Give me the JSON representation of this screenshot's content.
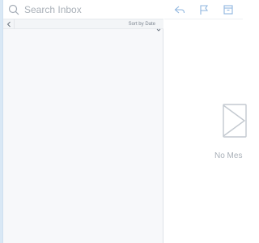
{
  "search": {
    "placeholder": "Search Inbox"
  },
  "list": {
    "sort_label": "Sort by Date"
  },
  "preview": {
    "empty_text": "No Mes"
  },
  "colors": {
    "accent": "#8fb6df",
    "icon_gray": "#c3c9d0"
  },
  "icons": {
    "search": "search-icon",
    "back": "chevron-left-icon",
    "sort": "chevron-down-icon",
    "reply": "reply-icon",
    "flag": "flag-icon",
    "archive": "archive-icon",
    "empty": "envelope-icon"
  }
}
